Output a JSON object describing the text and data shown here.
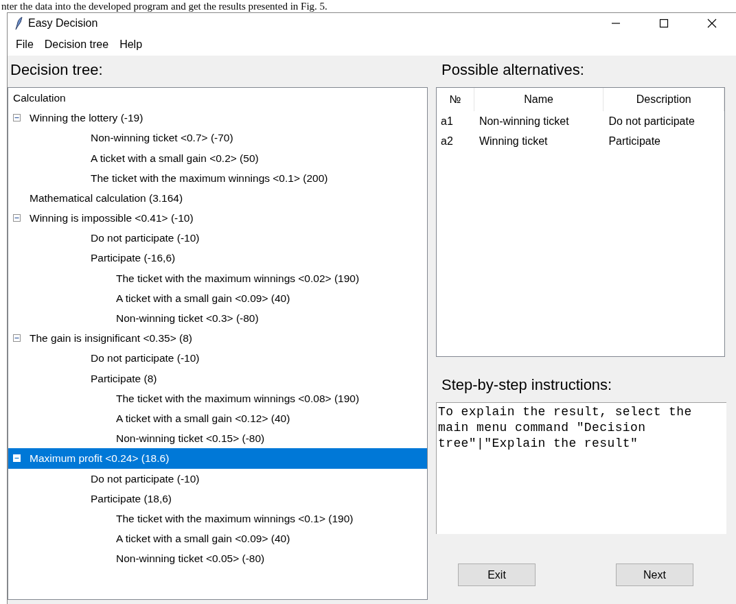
{
  "document_caption": "nter the data into the developed program and get the results presented in Fig. 5.",
  "window": {
    "title": "Easy Decision"
  },
  "menu": [
    "File",
    "Decision tree",
    "Help"
  ],
  "tree_panel": {
    "label": "Decision tree:",
    "heading": "Calculation",
    "items": [
      {
        "text": "Winning the lottery (-19)",
        "expanded": true,
        "selected": false,
        "children": [
          {
            "text": "Non-winning ticket <0.7> (-70)",
            "selected": false
          },
          {
            "text": "A ticket with a small gain <0.2> (50)",
            "selected": false
          },
          {
            "text": "The ticket with the maximum winnings <0.1> (200)",
            "selected": false
          }
        ]
      },
      {
        "text": "Mathematical calculation (3.164)",
        "selected": false
      },
      {
        "text": "Winning is impossible <0.41> (-10)",
        "expanded": true,
        "selected": false,
        "children": [
          {
            "text": "Do not participate (-10)",
            "selected": false
          },
          {
            "text": "Participate (-16,6)",
            "selected": false,
            "children": [
              {
                "text": "The ticket with the maximum winnings <0.02> (190)",
                "selected": false
              },
              {
                "text": "A ticket with a small gain <0.09> (40)",
                "selected": false
              },
              {
                "text": "Non-winning ticket <0.3> (-80)",
                "selected": false
              }
            ]
          }
        ]
      },
      {
        "text": "The gain is insignificant  <0.35> (8)",
        "expanded": true,
        "selected": false,
        "children": [
          {
            "text": "Do not participate (-10)",
            "selected": false
          },
          {
            "text": "Participate (8)",
            "selected": false,
            "children": [
              {
                "text": "The ticket with the maximum winnings <0.08> (190)",
                "selected": false
              },
              {
                "text": "A ticket with a small gain <0.12> (40)",
                "selected": false
              },
              {
                "text": "Non-winning ticket <0.15> (-80)",
                "selected": false
              }
            ]
          }
        ]
      },
      {
        "text": "Maximum profit <0.24> (18.6)",
        "expanded": true,
        "selected": true,
        "children": [
          {
            "text": "Do not participate (-10)",
            "selected": false
          },
          {
            "text": "Participate (18,6)",
            "selected": false,
            "children": [
              {
                "text": "The ticket with the maximum winnings <0.1> (190)",
                "selected": false
              },
              {
                "text": "A ticket with a small gain <0.09> (40)",
                "selected": false
              },
              {
                "text": "Non-winning ticket <0.05> (-80)",
                "selected": false
              }
            ]
          }
        ]
      }
    ]
  },
  "alternatives": {
    "label": "Possible alternatives:",
    "columns": [
      "№",
      "Name",
      "Description"
    ],
    "rows": [
      [
        "a1",
        "Non-winning ticket",
        "Do not participate"
      ],
      [
        "a2",
        "Winning ticket",
        "Participate"
      ]
    ]
  },
  "instructions": {
    "label": "Step-by-step instructions:",
    "value": "To explain the result, select the main menu command \"Decision tree\"|\"Explain the result\""
  },
  "buttons": [
    "Exit",
    "Next"
  ]
}
